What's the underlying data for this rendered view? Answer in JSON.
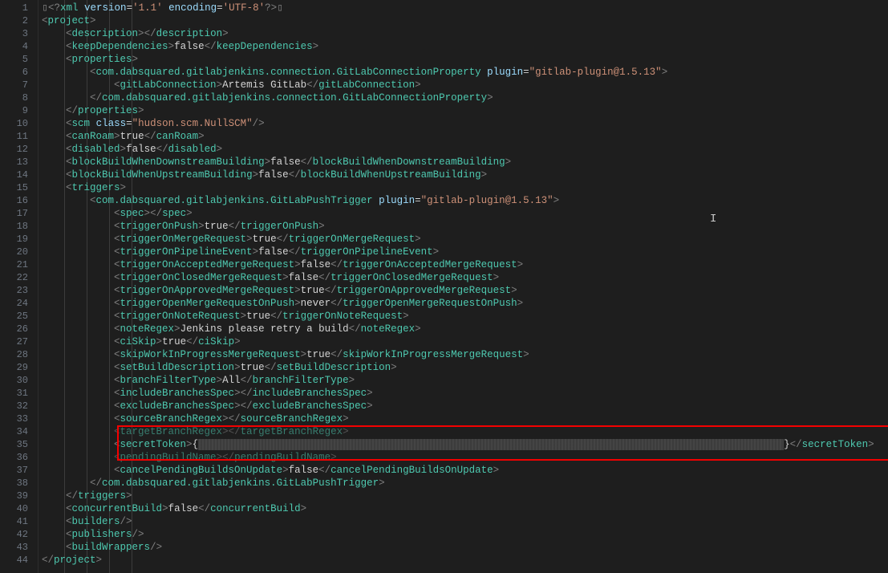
{
  "line_numbers": [
    "1",
    "2",
    "3",
    "4",
    "5",
    "6",
    "7",
    "8",
    "9",
    "10",
    "11",
    "12",
    "13",
    "14",
    "15",
    "16",
    "17",
    "18",
    "19",
    "20",
    "21",
    "22",
    "23",
    "24",
    "25",
    "26",
    "27",
    "28",
    "29",
    "30",
    "31",
    "32",
    "33",
    "34",
    "35",
    "36",
    "37",
    "38",
    "39",
    "40",
    "41",
    "42",
    "43",
    "44"
  ],
  "code": {
    "xml_decl": {
      "version": "1.1",
      "encoding": "UTF-8"
    },
    "project": {
      "description": "",
      "keepDependencies": "false",
      "properties": {
        "GitLabConnectionProperty": {
          "plugin": "gitlab-plugin@1.5.13",
          "gitLabConnection": "Artemis GitLab"
        }
      },
      "scm": {
        "class": "hudson.scm.NullSCM"
      },
      "canRoam": "true",
      "disabled": "false",
      "blockBuildWhenDownstreamBuilding": "false",
      "blockBuildWhenUpstreamBuilding": "false",
      "triggers": {
        "GitLabPushTrigger": {
          "plugin": "gitlab-plugin@1.5.13",
          "spec": "",
          "triggerOnPush": "true",
          "triggerOnMergeRequest": "true",
          "triggerOnPipelineEvent": "false",
          "triggerOnAcceptedMergeRequest": "false",
          "triggerOnClosedMergeRequest": "false",
          "triggerOnApprovedMergeRequest": "true",
          "triggerOpenMergeRequestOnPush": "never",
          "triggerOnNoteRequest": "true",
          "noteRegex": "Jenkins please retry a build",
          "ciSkip": "true",
          "skipWorkInProgressMergeRequest": "true",
          "setBuildDescription": "true",
          "branchFilterType": "All",
          "includeBranchesSpec": "",
          "excludeBranchesSpec": "",
          "sourceBranchRegex": "",
          "targetBranchRegex": "",
          "secretToken": "{REDACTED}",
          "pendingBuildName": "",
          "cancelPendingBuildsOnUpdate": "false"
        }
      },
      "concurrentBuild": "false",
      "builders": "",
      "publishers": "",
      "buildWrappers": ""
    }
  },
  "highlight": {
    "line_start": 34,
    "line_end": 36
  },
  "cursor": {
    "line": 17,
    "col": 120
  }
}
